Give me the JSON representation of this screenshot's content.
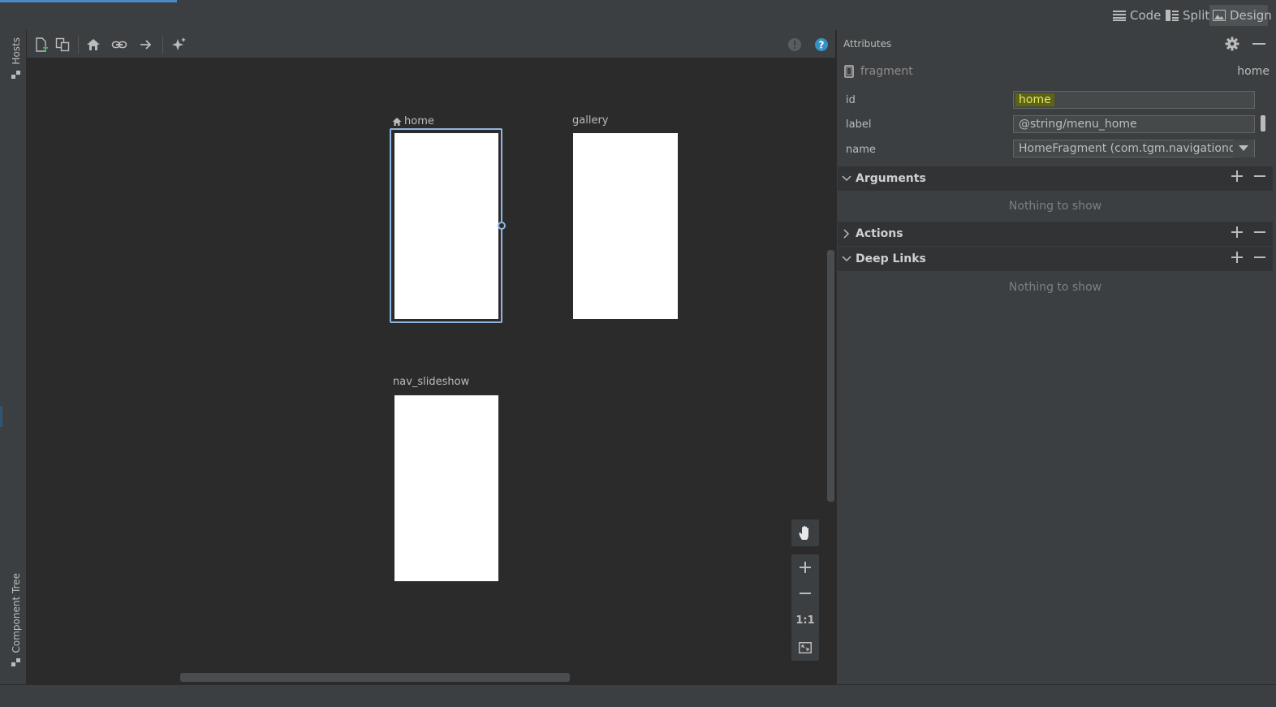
{
  "top_bar": {
    "modes": [
      {
        "label": "Code",
        "icon": "lines-icon"
      },
      {
        "label": "Split",
        "icon": "split-icon"
      },
      {
        "label": "Design",
        "icon": "image-icon",
        "active": true
      }
    ]
  },
  "left_strip": {
    "hosts_label": "Hosts",
    "component_tree_label": "Component Tree"
  },
  "canvas_toolbar": {
    "icons": [
      "new-destination-icon",
      "nested-graph-icon",
      "home-icon",
      "deep-link-icon",
      "action-arrow-icon",
      "auto-arrange-icon",
      "warning-icon",
      "help-icon"
    ]
  },
  "destinations": [
    {
      "label": "home",
      "start_destination": true,
      "selected": true
    },
    {
      "label": "gallery",
      "start_destination": false,
      "selected": false
    },
    {
      "label": "nav_slideshow",
      "start_destination": false,
      "selected": false
    }
  ],
  "zoom_controls": {
    "one_to_one_label": "1:1",
    "icons": [
      "pan-hand-icon",
      "zoom-in-icon",
      "zoom-out-icon",
      "fit-screen-icon"
    ]
  },
  "attributes": {
    "title": "Attributes",
    "element_type": "fragment",
    "element_id": "home",
    "fields": {
      "id_label": "id",
      "id_value": "home",
      "label_label": "label",
      "label_value": "@string/menu_home",
      "name_label": "name",
      "name_value": "HomeFragment (com.tgm.navigationdr"
    },
    "sections": {
      "arguments": "Arguments",
      "arguments_empty": "Nothing to show",
      "actions": "Actions",
      "deep_links": "Deep Links",
      "deep_links_empty": "Nothing to show"
    }
  },
  "colors": {
    "selection_border": "#8db6e0",
    "id_highlight": "#5c6313",
    "help_icon": "#3592c4",
    "new_destination_plus": "#59a869"
  }
}
